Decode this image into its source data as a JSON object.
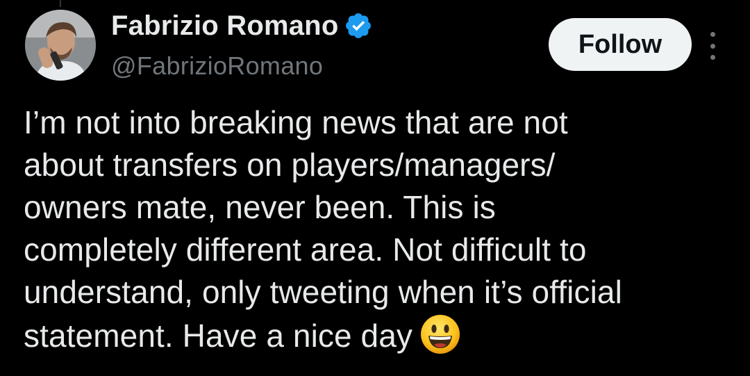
{
  "author": {
    "display_name": "Fabrizio Romano",
    "handle": "@FabrizioRomano",
    "verified": true,
    "verified_icon": "verified-badge-icon",
    "avatar": "profile-photo"
  },
  "actions": {
    "follow_label": "Follow",
    "more_icon": "more-options-icon"
  },
  "tweet": {
    "lines": [
      "I’m not into breaking news that are not",
      "about transfers on players/managers/",
      "owners mate, never been. This is",
      "completely different area. Not difficult to",
      "understand, only tweeting when it’s official",
      "statement. Have a nice day"
    ],
    "trailing_emoji": "smiling-face-emoji"
  },
  "colors": {
    "background": "#000000",
    "text_primary": "#e7e9ea",
    "text_secondary": "#71767b",
    "verified_blue": "#1d9bf0",
    "follow_bg": "#eff3f4",
    "follow_text": "#0f1419"
  }
}
